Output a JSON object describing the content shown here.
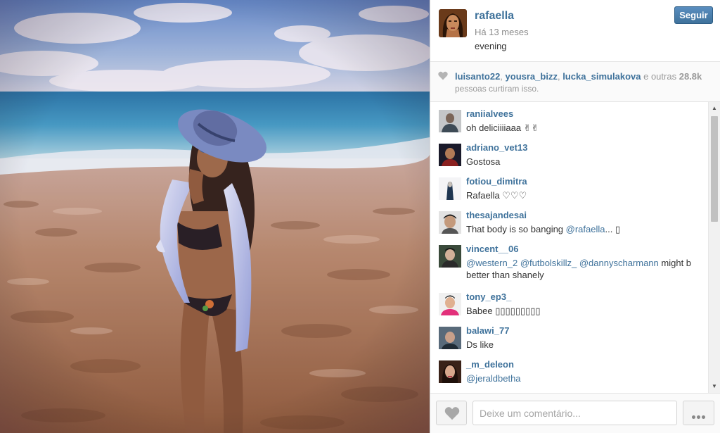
{
  "post": {
    "username": "rafaella",
    "time": "Há 13 meses",
    "caption": "evening",
    "follow_label": "Seguir"
  },
  "likes": {
    "users": [
      "luisanto22",
      "yousra_bizz",
      "lucka_simulakova"
    ],
    "and_others": "e outras",
    "count": "28.8k",
    "suffix": "pessoas curtiram isso."
  },
  "comments": [
    {
      "user": "raniialvees",
      "text": "oh deliciiiiaaa ✌✌"
    },
    {
      "user": "adriano_vet13",
      "text": "Gostosa"
    },
    {
      "user": "fotiou_dimitra",
      "text": "Rafaella ♡♡♡"
    },
    {
      "user": "thesajandesai",
      "text_pre": "That body is so banging ",
      "mention": "@rafaella",
      "text_post": "... ▯"
    },
    {
      "user": "vincent__06",
      "mentions": [
        "@western_2",
        "@futbolskillz_",
        "@dannyscharmann"
      ],
      "text_post": " might b",
      "line2": "better than shanely"
    },
    {
      "user": "tony_ep3_",
      "text": "Babee ▯▯▯▯▯▯▯▯▯"
    },
    {
      "user": "balawi_77",
      "text": "Ds like"
    },
    {
      "user": "_m_deleon",
      "mention": "@jeraldbetha"
    }
  ],
  "footer": {
    "comment_placeholder": "Deixe um comentário..."
  },
  "colors": {
    "link": "#3f729b",
    "follow_button": "#3f729b"
  },
  "icons": {
    "like": "heart-icon",
    "more": "ellipsis-icon"
  }
}
